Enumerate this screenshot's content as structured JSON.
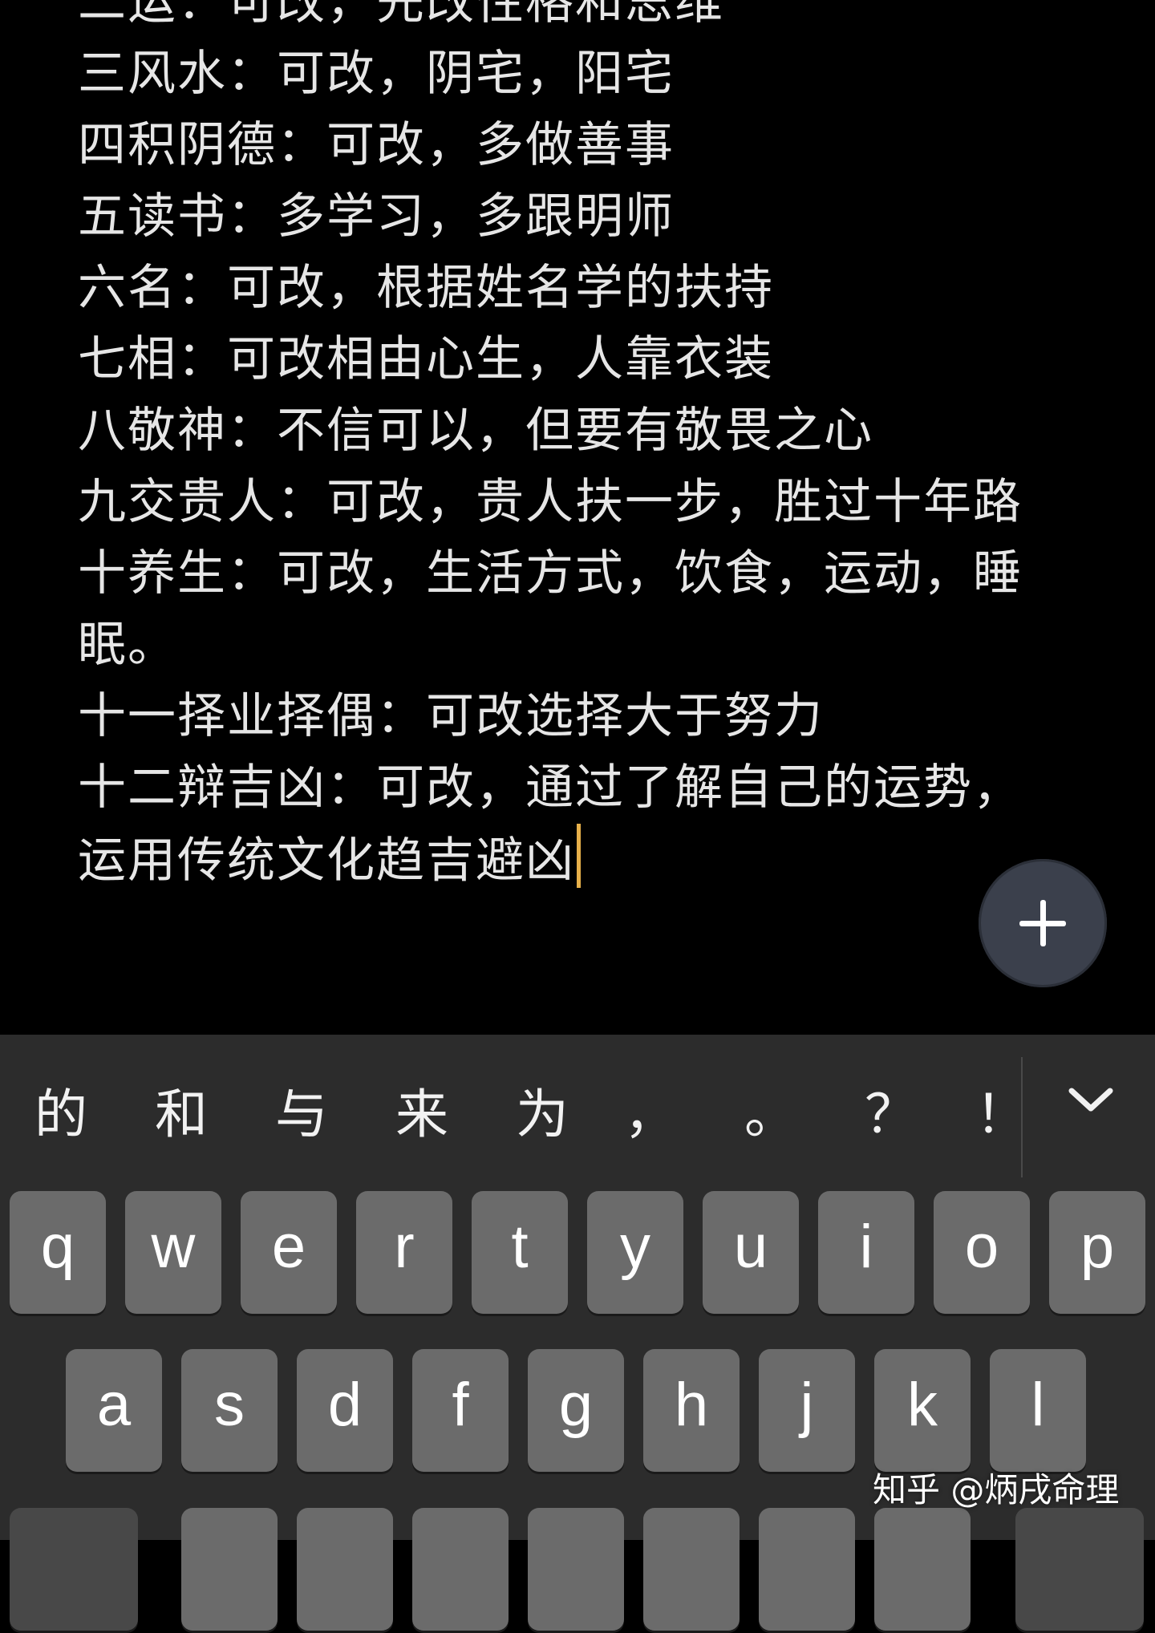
{
  "note": {
    "lines": [
      "二运：可改，先改性格和思维",
      "三风水：可改，阴宅，阳宅",
      "四积阴德：可改，多做善事",
      "五读书：多学习，多跟明师",
      "六名：可改，根据姓名学的扶持",
      "七相：可改相由心生，人靠衣装",
      "八敬神：不信可以，但要有敬畏之心",
      "九交贵人：可改，贵人扶一步，胜过十年路",
      "十养生：可改，生活方式，饮食，运动，睡",
      "眠。",
      "十一择业择偶：可改选择大于努力",
      "十二辩吉凶：可改，通过了解自己的运势，",
      "运用传统文化趋吉避凶"
    ],
    "colors": {
      "text": "#e6e6e6",
      "caret": "#e7b04a",
      "background": "#000000"
    }
  },
  "fab": {
    "icon": "plus-icon",
    "color": "#3b404c"
  },
  "keyboard": {
    "candidates": [
      "的",
      "和",
      "与",
      "来",
      "为",
      "，",
      "。",
      "？",
      "！"
    ],
    "collapse_icon": "chevron-down-icon",
    "row1": [
      "q",
      "w",
      "e",
      "r",
      "t",
      "y",
      "u",
      "i",
      "o",
      "p"
    ],
    "row2": [
      "a",
      "s",
      "d",
      "f",
      "g",
      "h",
      "j",
      "k",
      "l"
    ],
    "colors": {
      "background": "#2c2c2c",
      "key": "#6b6b6b",
      "key_dark": "#484848"
    }
  },
  "watermark": "知乎 @炳戌命理"
}
